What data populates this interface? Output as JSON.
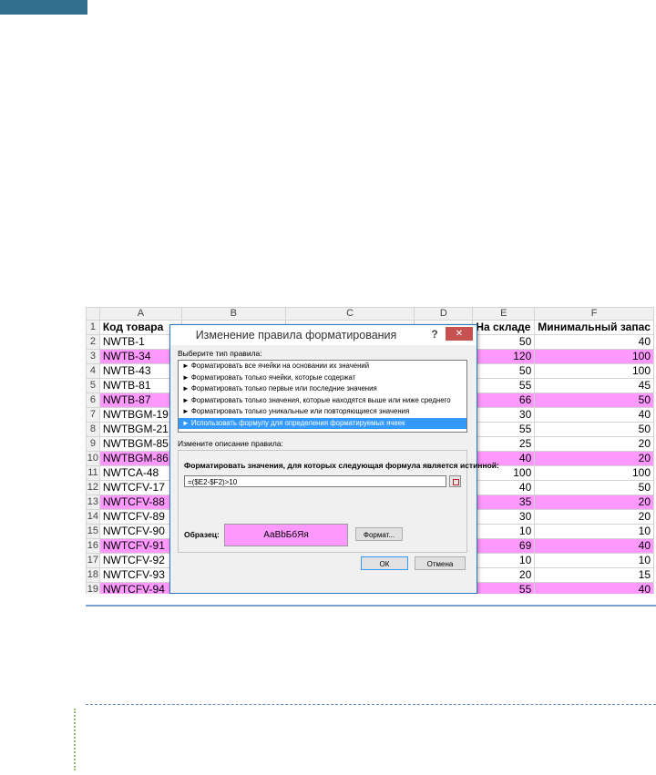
{
  "sheet": {
    "columns": [
      "A",
      "B",
      "C",
      "D",
      "E",
      "F"
    ],
    "header": {
      "row": "1",
      "a": "Код товара",
      "e": "На складе",
      "f": "Минимальный запас"
    },
    "rows": [
      {
        "row": "2",
        "a": "NWTB-1",
        "e": "50",
        "f": "40"
      },
      {
        "row": "3",
        "a": "NWTB-34",
        "e": "120",
        "f": "100"
      },
      {
        "row": "4",
        "a": "NWTB-43",
        "e": "50",
        "f": "100"
      },
      {
        "row": "5",
        "a": "NWTB-81",
        "e": "55",
        "f": "45"
      },
      {
        "row": "6",
        "a": "NWTB-87",
        "e": "66",
        "f": "50"
      },
      {
        "row": "7",
        "a": "NWTBGM-19",
        "e": "30",
        "f": "40"
      },
      {
        "row": "8",
        "a": "NWTBGM-21",
        "e": "55",
        "f": "50"
      },
      {
        "row": "9",
        "a": "NWTBGM-85",
        "e": "25",
        "f": "20"
      },
      {
        "row": "10",
        "a": "NWTBGM-86",
        "e": "40",
        "f": "20"
      },
      {
        "row": "11",
        "a": "NWTCA-48",
        "e": "100",
        "f": "100"
      },
      {
        "row": "12",
        "a": "NWTCFV-17",
        "e": "40",
        "f": "50"
      },
      {
        "row": "13",
        "a": "NWTCFV-88",
        "e": "35",
        "f": "20"
      },
      {
        "row": "14",
        "a": "NWTCFV-89",
        "e": "30",
        "f": "20"
      },
      {
        "row": "15",
        "a": "NWTCFV-90",
        "e": "10",
        "f": "10"
      },
      {
        "row": "16",
        "a": "NWTCFV-91",
        "e": "69",
        "f": "40"
      },
      {
        "row": "17",
        "a": "NWTCFV-92",
        "e": "10",
        "f": "10"
      },
      {
        "row": "18",
        "a": "NWTCFV-93",
        "e": "20",
        "f": "15"
      },
      {
        "row": "19",
        "a": "NWTCFV-94",
        "e": "55",
        "f": "40"
      }
    ],
    "highlight_color": "#ff99ff"
  },
  "dialog": {
    "title": "Изменение правила форматирования",
    "help": "?",
    "close": "✕",
    "select_type_label": "Выберите тип правила:",
    "rule_types": [
      "► Форматировать все ячейки на основании их значений",
      "► Форматировать только ячейки, которые содержат",
      "► Форматировать только первые или последние значения",
      "► Форматировать только значения, которые находятся выше или ниже среднего",
      "► Форматировать только уникальные или повторяющиеся значения",
      "► Использовать формулу для определения форматируемых ячеек"
    ],
    "edit_desc_label": "Измените описание правила:",
    "formula_label": "Форматировать значения, для которых следующая формула является истинной:",
    "formula_value": "=($E2-$F2)>10",
    "sample_label": "Образец:",
    "sample_text": "АаBbБбЯя",
    "format_button": "Формат...",
    "ok_button": "ОК",
    "cancel_button": "Отмена",
    "selected_color": "#3399ff"
  }
}
